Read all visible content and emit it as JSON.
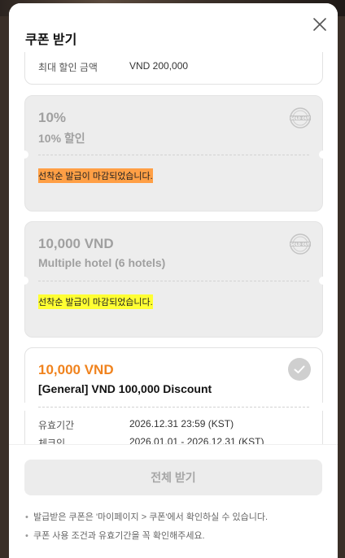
{
  "modal": {
    "title": "쿠폰 받기"
  },
  "card_top": {
    "label": "최대 할인 금액",
    "value": "VND 200,000"
  },
  "coupons": [
    {
      "amount": "10%",
      "name": "10% 할인",
      "notice": "선착순 발급이 마감되었습니다.",
      "notice_color": "#ff9f45",
      "status": "SOLD OUT"
    },
    {
      "amount": "10,000 VND",
      "name": "Multiple hotel (6 hotels)",
      "notice": "선착순 발급이 마감되었습니다.",
      "notice_color": "#ffff33",
      "status": "SOLD OUT"
    },
    {
      "amount": "10,000 VND",
      "name": "[General] VND 100,000 Discount",
      "amount_color": "#f0831e",
      "rows": [
        {
          "label": "유효기간",
          "value": "2026.12.31 23:59 (KST)"
        },
        {
          "label": "체크인",
          "value": "2026.01.01 - 2026.12.31 (KST)"
        }
      ]
    }
  ],
  "footer": {
    "button_label": "전체 받기",
    "notes": [
      "발급받은 쿠폰은 '마이페이지 > 쿠폰'에서 확인하실 수 있습니다.",
      "쿠폰 사용 조건과 유효기간을 꼭 확인해주세요."
    ]
  },
  "icons": {
    "close": "close-icon",
    "soldout": "sold-out-badge-icon",
    "check": "check-circle-icon"
  }
}
